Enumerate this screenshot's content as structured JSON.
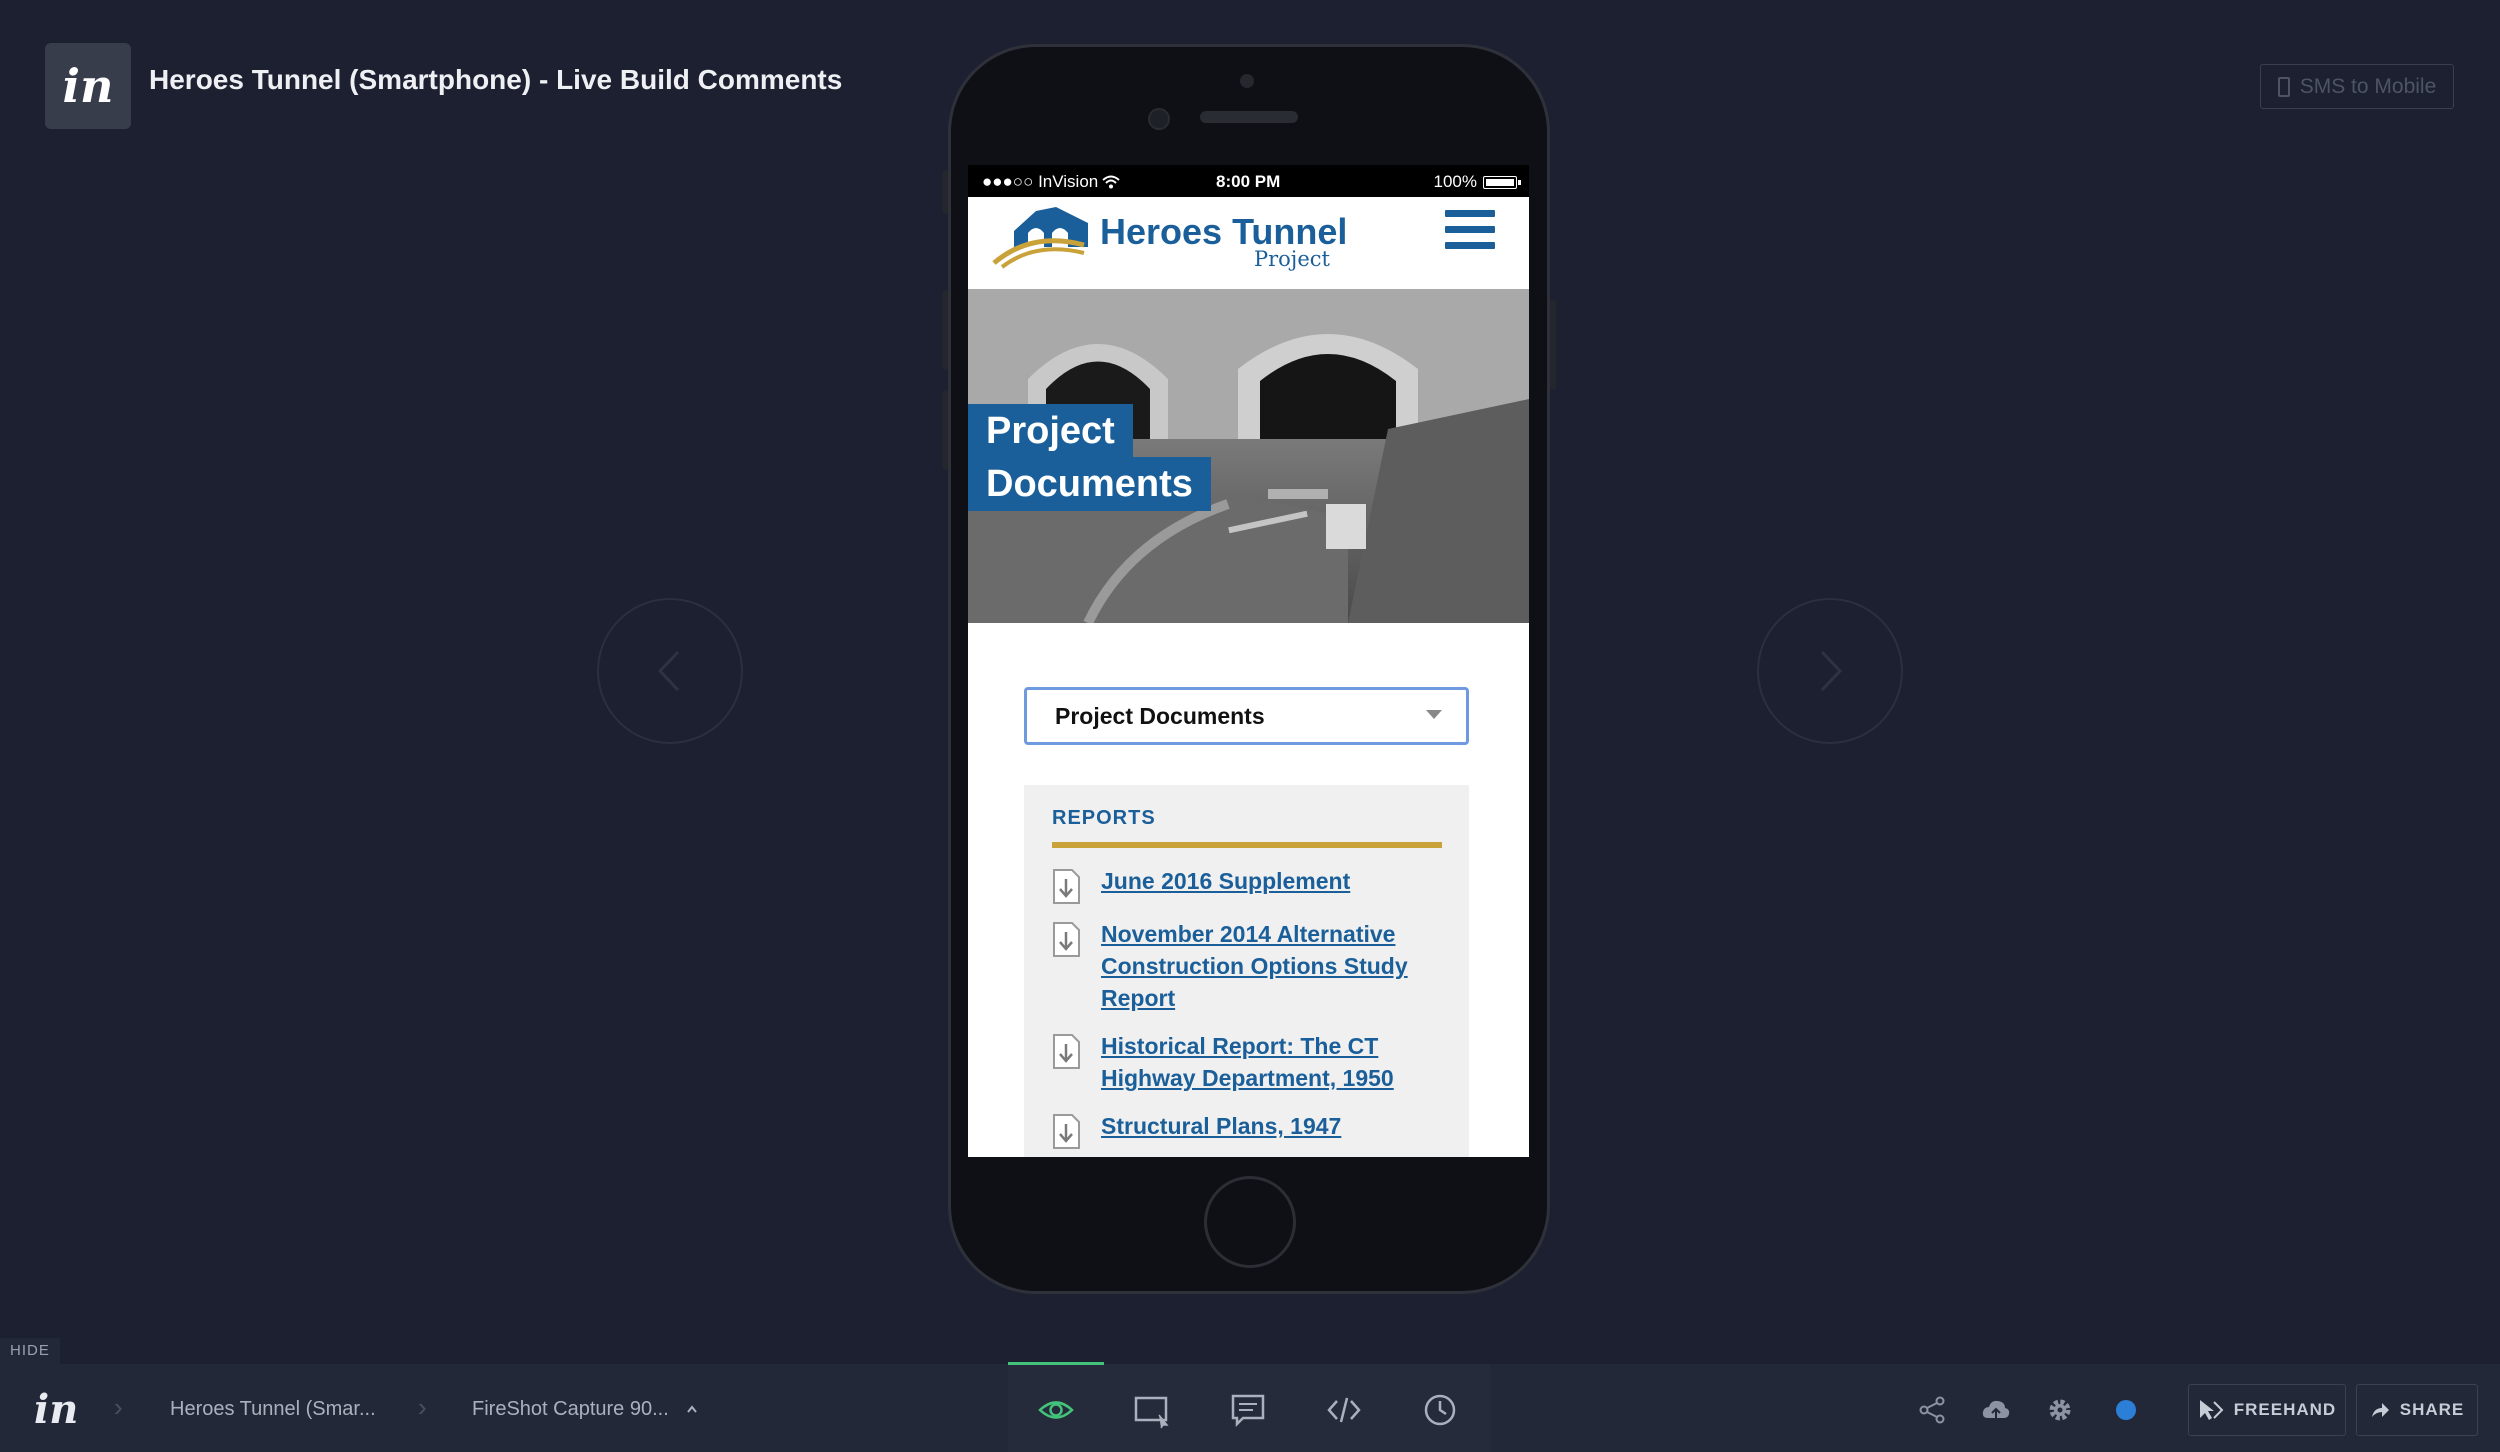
{
  "header": {
    "logo_text": "in",
    "project_title": "Heroes Tunnel (Smartphone) - Live Build Comments",
    "sms_label": "SMS to Mobile"
  },
  "phone": {
    "status_bar": {
      "carrier": "●●●○○ InVision",
      "time": "8:00 PM",
      "battery": "100%"
    },
    "site": {
      "brand_main": "Heroes Tunnel",
      "brand_sub": "Project",
      "hero_line1": "Project",
      "hero_line2": "Documents",
      "select_value": "Project Documents",
      "reports_heading": "REPORTS",
      "documents": [
        "June 2016 Supplement",
        "November 2014 Alternative Construction Options Study Report",
        "Historical Report: The CT Highway Department, 1950",
        "Structural Plans, 1947"
      ]
    }
  },
  "bottom_bar": {
    "hide_label": "HIDE",
    "logo_text": "in",
    "breadcrumb_project": "Heroes Tunnel (Smar...",
    "breadcrumb_screen": "FireShot Capture 90...",
    "freehand_label": "FREEHAND",
    "share_label": "SHARE"
  },
  "colors": {
    "background": "#1c2030",
    "brand_blue": "#1b5f9a",
    "accent_gold": "#c9a23a",
    "active_tool": "#43c27a",
    "status_dot": "#2b7fd6"
  },
  "icons": [
    "phone-icon",
    "arrow-left-icon",
    "arrow-right-icon",
    "hamburger-menu-icon",
    "download-doc-icon",
    "eye-icon",
    "screen-cursor-icon",
    "comment-icon",
    "code-icon",
    "clock-icon",
    "share-nodes-icon",
    "cloud-upload-icon",
    "gear-icon",
    "freehand-cursor-icon",
    "share-arrow-icon"
  ]
}
